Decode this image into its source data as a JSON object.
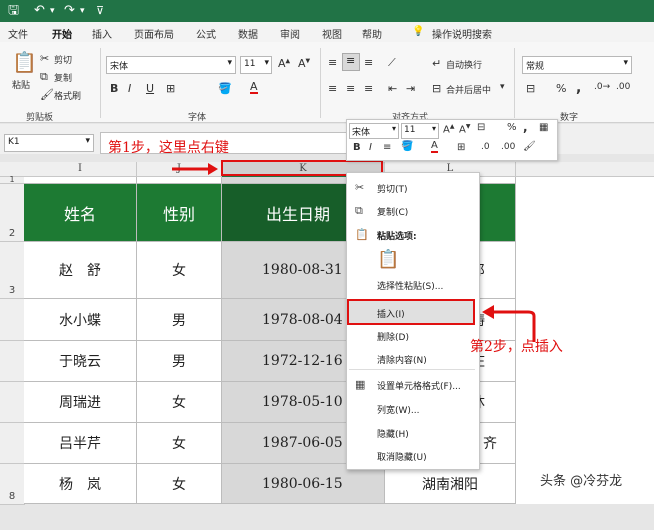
{
  "menu": [
    "文件",
    "开始",
    "插入",
    "页面布局",
    "公式",
    "数据",
    "审阅",
    "视图",
    "帮助",
    "操作说明搜索"
  ],
  "ribbon": {
    "paste": "粘贴",
    "cut": "剪切",
    "copy": "复制",
    "format_painter": "格式刷",
    "font_name": "宋体",
    "font_size": "11",
    "wrap_text": "自动换行",
    "merge_center": "合并后居中",
    "number_format": "常规",
    "groups": {
      "clipboard": "剪贴板",
      "font": "字体",
      "alignment": "对齐方式",
      "number": "数字"
    }
  },
  "name_box": "K1",
  "columns": {
    "I": "I",
    "J": "J",
    "K": "K",
    "L": "L"
  },
  "rows": [
    "1",
    "2",
    "3",
    "4",
    "5",
    "6",
    "7",
    "8"
  ],
  "table": {
    "headers": [
      "姓名",
      "性别",
      "出生日期",
      ""
    ],
    "rows": [
      [
        "赵　舒",
        "女",
        "1980-08-31",
        "郎"
      ],
      [
        "水小蝶",
        "男",
        "1978-08-04",
        "涛"
      ],
      [
        "于晓云",
        "男",
        "1972-12-16",
        "庄"
      ],
      [
        "周瑞进",
        "女",
        "1978-05-10",
        "沐"
      ],
      [
        "吕半芹",
        "女",
        "1987-06-05",
        "齐"
      ],
      [
        "杨　岚",
        "女",
        "1980-06-15",
        "湖南湘阳"
      ]
    ]
  },
  "mini_toolbar": {
    "font_name": "宋体",
    "font_size": "11"
  },
  "context_menu": {
    "cut": "剪切(T)",
    "copy": "复制(C)",
    "paste_options": "粘贴选项:",
    "paste_special": "选择性粘贴(S)...",
    "insert": "插入(I)",
    "delete": "删除(D)",
    "clear_contents": "清除内容(N)",
    "format_cells": "设置单元格格式(F)...",
    "column_width": "列宽(W)...",
    "hide": "隐藏(H)",
    "unhide": "取消隐藏(U)"
  },
  "annotations": {
    "step1": "第1步，这里点右键",
    "step2": "第2步，点插入"
  },
  "watermark": "头条 @冷芬龙",
  "colors": {
    "excel_green": "#217346",
    "table_header": "#1d7a33",
    "annotation_red": "#e01010"
  }
}
